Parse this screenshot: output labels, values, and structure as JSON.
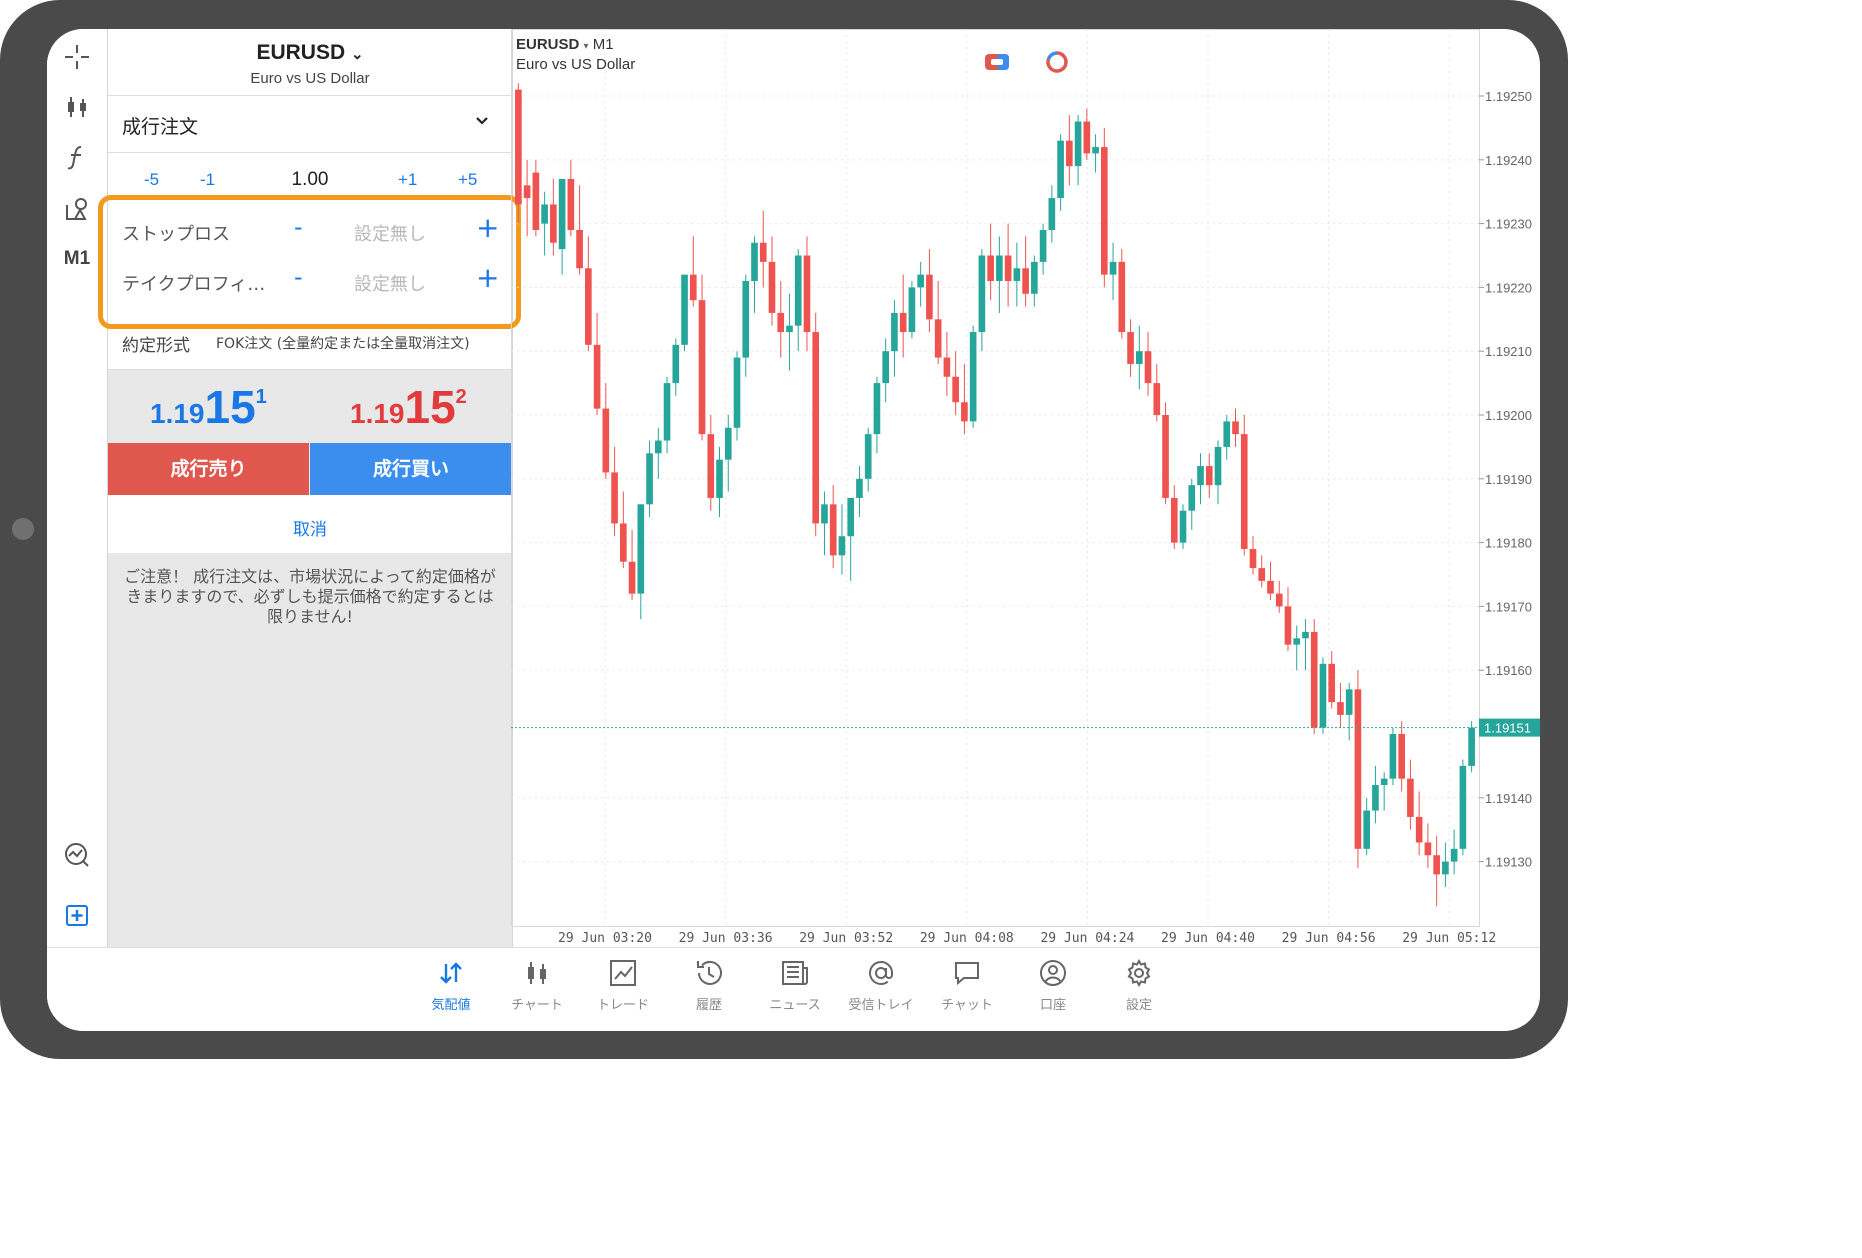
{
  "colors": {
    "accent": "#1a78e6",
    "bull": "#26a69a",
    "bear": "#ef5350",
    "sell": "#e0574d",
    "buy": "#3b8dee",
    "highlight": "#f39a1e"
  },
  "toolbar": {
    "icons": [
      "crosshair-icon",
      "chart-type-icon",
      "indicator-icon",
      "objects-icon"
    ],
    "timeframe": "M1",
    "bottom_icons": [
      "signal-analysis-icon",
      "new-order-icon"
    ]
  },
  "order": {
    "symbol": "EURUSD",
    "symbol_desc": "Euro vs US Dollar",
    "type": "成行注文",
    "volume": {
      "minus5": "-5",
      "minus1": "-1",
      "value": "1.00",
      "plus1": "+1",
      "plus5": "+5"
    },
    "stop_loss": {
      "label": "ストップロス",
      "minus": "-",
      "value": "設定無し",
      "plus": "+"
    },
    "take_profit": {
      "label": "テイクプロフィ…",
      "minus": "-",
      "value": "設定無し",
      "plus": "+"
    },
    "fill_policy": {
      "label": "約定形式",
      "value": "FOK注文 (全量約定または全量取消注文)"
    },
    "bid": {
      "small": "1.19",
      "big": "15",
      "sup": "1"
    },
    "ask": {
      "small": "1.19",
      "big": "15",
      "sup": "2"
    },
    "sell_label": "成行売り",
    "buy_label": "成行買い",
    "cancel_label": "取消",
    "warning": "ご注意！ 成行注文は、市場状況によって約定価格がきまりますので、必ずしも提示価格で約定するとは限りません!"
  },
  "chart": {
    "symbol": "EURUSD",
    "timeframe": "M1",
    "description": "Euro vs US Dollar",
    "icons": [
      "one-click-trading-icon",
      "signal-icon"
    ]
  },
  "chart_data": {
    "type": "candlestick",
    "symbol": "EURUSD",
    "timeframe": "M1",
    "y_ticks": [
      "1.19250",
      "1.19240",
      "1.19230",
      "1.19220",
      "1.19210",
      "1.19200",
      "1.19190",
      "1.19180",
      "1.19170",
      "1.19160",
      "1.19140",
      "1.19130"
    ],
    "x_ticks": [
      "29 Jun 03:20",
      "29 Jun 03:36",
      "29 Jun 03:52",
      "29 Jun 04:08",
      "29 Jun 04:24",
      "29 Jun 04:40",
      "29 Jun 04:56",
      "29 Jun 05:12"
    ],
    "current_price": "1.19151",
    "grid": true,
    "candles": [
      [
        1.19251,
        1.19252,
        1.1923,
        1.19233
      ],
      [
        1.19236,
        1.1924,
        1.19228,
        1.19234
      ],
      [
        1.19238,
        1.1924,
        1.19228,
        1.19229
      ],
      [
        1.1923,
        1.19235,
        1.19225,
        1.19233
      ],
      [
        1.19233,
        1.19237,
        1.19225,
        1.19227
      ],
      [
        1.19226,
        1.19237,
        1.19222,
        1.19237
      ],
      [
        1.19237,
        1.1924,
        1.19228,
        1.19229
      ],
      [
        1.19229,
        1.19236,
        1.19222,
        1.19223
      ],
      [
        1.19223,
        1.19228,
        1.1921,
        1.19211
      ],
      [
        1.19211,
        1.19216,
        1.192,
        1.19201
      ],
      [
        1.19201,
        1.19205,
        1.1919,
        1.19191
      ],
      [
        1.19191,
        1.19195,
        1.19181,
        1.19183
      ],
      [
        1.19183,
        1.19188,
        1.19176,
        1.19177
      ],
      [
        1.19177,
        1.19182,
        1.19171,
        1.19172
      ],
      [
        1.19172,
        1.19186,
        1.19168,
        1.19186
      ],
      [
        1.19186,
        1.19196,
        1.19184,
        1.19194
      ],
      [
        1.19194,
        1.19198,
        1.1919,
        1.19196
      ],
      [
        1.19196,
        1.19206,
        1.19194,
        1.19205
      ],
      [
        1.19205,
        1.19212,
        1.19203,
        1.19211
      ],
      [
        1.19211,
        1.19222,
        1.1921,
        1.19222
      ],
      [
        1.19222,
        1.19228,
        1.19217,
        1.19218
      ],
      [
        1.19218,
        1.19222,
        1.19196,
        1.19197
      ],
      [
        1.19197,
        1.192,
        1.19185,
        1.19187
      ],
      [
        1.19187,
        1.19195,
        1.19184,
        1.19193
      ],
      [
        1.19193,
        1.192,
        1.19188,
        1.19198
      ],
      [
        1.19198,
        1.1921,
        1.19196,
        1.19209
      ],
      [
        1.19209,
        1.19222,
        1.19206,
        1.19221
      ],
      [
        1.19221,
        1.19228,
        1.19216,
        1.19227
      ],
      [
        1.19227,
        1.19232,
        1.1922,
        1.19224
      ],
      [
        1.19224,
        1.19228,
        1.19214,
        1.19216
      ],
      [
        1.19216,
        1.19221,
        1.19209,
        1.19213
      ],
      [
        1.19213,
        1.19219,
        1.19207,
        1.19214
      ],
      [
        1.19214,
        1.19226,
        1.1921,
        1.19225
      ],
      [
        1.19225,
        1.19228,
        1.1921,
        1.19213
      ],
      [
        1.19213,
        1.19216,
        1.19181,
        1.19183
      ],
      [
        1.19183,
        1.19188,
        1.19178,
        1.19186
      ],
      [
        1.19186,
        1.19189,
        1.19176,
        1.19178
      ],
      [
        1.19178,
        1.19186,
        1.19175,
        1.19181
      ],
      [
        1.19181,
        1.19186,
        1.19174,
        1.19187
      ],
      [
        1.19187,
        1.19192,
        1.19184,
        1.1919
      ],
      [
        1.1919,
        1.19198,
        1.19188,
        1.19197
      ],
      [
        1.19197,
        1.19206,
        1.19194,
        1.19205
      ],
      [
        1.19205,
        1.19212,
        1.19202,
        1.1921
      ],
      [
        1.1921,
        1.19218,
        1.19206,
        1.19216
      ],
      [
        1.19216,
        1.19222,
        1.19209,
        1.19213
      ],
      [
        1.19213,
        1.19221,
        1.19212,
        1.1922
      ],
      [
        1.1922,
        1.19224,
        1.19217,
        1.19222
      ],
      [
        1.19222,
        1.19226,
        1.19213,
        1.19215
      ],
      [
        1.19215,
        1.19221,
        1.19208,
        1.19209
      ],
      [
        1.19209,
        1.19213,
        1.19203,
        1.19206
      ],
      [
        1.19206,
        1.1921,
        1.192,
        1.19202
      ],
      [
        1.19202,
        1.19208,
        1.19197,
        1.19199
      ],
      [
        1.19199,
        1.19214,
        1.19198,
        1.19213
      ],
      [
        1.19213,
        1.19226,
        1.1921,
        1.19225
      ],
      [
        1.19225,
        1.1923,
        1.19218,
        1.19221
      ],
      [
        1.19221,
        1.19228,
        1.19216,
        1.19225
      ],
      [
        1.19225,
        1.1923,
        1.19217,
        1.19221
      ],
      [
        1.19221,
        1.19227,
        1.19217,
        1.19223
      ],
      [
        1.19223,
        1.19228,
        1.19217,
        1.19219
      ],
      [
        1.19219,
        1.19225,
        1.19217,
        1.19224
      ],
      [
        1.19224,
        1.1923,
        1.19222,
        1.19229
      ],
      [
        1.19229,
        1.19236,
        1.19227,
        1.19234
      ],
      [
        1.19234,
        1.19244,
        1.19232,
        1.19243
      ],
      [
        1.19243,
        1.19247,
        1.19236,
        1.19239
      ],
      [
        1.19239,
        1.19247,
        1.19236,
        1.19246
      ],
      [
        1.19246,
        1.19248,
        1.1924,
        1.19241
      ],
      [
        1.19241,
        1.19244,
        1.19238,
        1.19242
      ],
      [
        1.19242,
        1.19245,
        1.1922,
        1.19222
      ],
      [
        1.19222,
        1.19227,
        1.19218,
        1.19224
      ],
      [
        1.19224,
        1.19226,
        1.19212,
        1.19213
      ],
      [
        1.19213,
        1.19215,
        1.19206,
        1.19208
      ],
      [
        1.19208,
        1.19214,
        1.19204,
        1.1921
      ],
      [
        1.1921,
        1.19213,
        1.19203,
        1.19205
      ],
      [
        1.19205,
        1.19208,
        1.19199,
        1.192
      ],
      [
        1.192,
        1.19202,
        1.19186,
        1.19187
      ],
      [
        1.19187,
        1.19189,
        1.19179,
        1.1918
      ],
      [
        1.1918,
        1.19186,
        1.19179,
        1.19185
      ],
      [
        1.19185,
        1.1919,
        1.19182,
        1.19189
      ],
      [
        1.19189,
        1.19194,
        1.19186,
        1.19192
      ],
      [
        1.19192,
        1.19194,
        1.19187,
        1.19189
      ],
      [
        1.19189,
        1.19196,
        1.19186,
        1.19195
      ],
      [
        1.19195,
        1.192,
        1.19193,
        1.19199
      ],
      [
        1.19199,
        1.19201,
        1.19195,
        1.19197
      ],
      [
        1.19197,
        1.192,
        1.19178,
        1.19179
      ],
      [
        1.19179,
        1.19181,
        1.19175,
        1.19176
      ],
      [
        1.19176,
        1.19178,
        1.19173,
        1.19174
      ],
      [
        1.19174,
        1.19177,
        1.19171,
        1.19172
      ],
      [
        1.19172,
        1.19174,
        1.19169,
        1.1917
      ],
      [
        1.1917,
        1.19173,
        1.19163,
        1.19164
      ],
      [
        1.19164,
        1.19167,
        1.1916,
        1.19165
      ],
      [
        1.19165,
        1.19168,
        1.1916,
        1.19166
      ],
      [
        1.19166,
        1.19168,
        1.1915,
        1.19151
      ],
      [
        1.19151,
        1.19162,
        1.1915,
        1.19161
      ],
      [
        1.19161,
        1.19163,
        1.19154,
        1.19155
      ],
      [
        1.19155,
        1.19158,
        1.19151,
        1.19153
      ],
      [
        1.19153,
        1.19158,
        1.19149,
        1.19157
      ],
      [
        1.19157,
        1.1916,
        1.19129,
        1.19132
      ],
      [
        1.19132,
        1.1914,
        1.19131,
        1.19138
      ],
      [
        1.19138,
        1.19145,
        1.19136,
        1.19142
      ],
      [
        1.19142,
        1.19144,
        1.19138,
        1.19143
      ],
      [
        1.19143,
        1.19151,
        1.19142,
        1.1915
      ],
      [
        1.1915,
        1.19152,
        1.19141,
        1.19143
      ],
      [
        1.19143,
        1.19146,
        1.19135,
        1.19137
      ],
      [
        1.19137,
        1.19141,
        1.19131,
        1.19133
      ],
      [
        1.19133,
        1.19136,
        1.19129,
        1.19131
      ],
      [
        1.19131,
        1.19134,
        1.19123,
        1.19128
      ],
      [
        1.19128,
        1.19133,
        1.19126,
        1.1913
      ],
      [
        1.1913,
        1.19135,
        1.19128,
        1.19132
      ],
      [
        1.19132,
        1.19146,
        1.19131,
        1.19145
      ],
      [
        1.19145,
        1.19152,
        1.19144,
        1.19151
      ]
    ]
  },
  "tabs": [
    {
      "label": "気配値",
      "icon": "quotes-icon",
      "active": true
    },
    {
      "label": "チャート",
      "icon": "chart-icon",
      "active": false
    },
    {
      "label": "トレード",
      "icon": "trade-icon",
      "active": false
    },
    {
      "label": "履歴",
      "icon": "history-icon",
      "active": false
    },
    {
      "label": "ニュース",
      "icon": "news-icon",
      "active": false
    },
    {
      "label": "受信トレイ",
      "icon": "mailbox-icon",
      "active": false
    },
    {
      "label": "チャット",
      "icon": "chat-icon",
      "active": false
    },
    {
      "label": "口座",
      "icon": "account-icon",
      "active": false
    },
    {
      "label": "設定",
      "icon": "settings-icon",
      "active": false
    }
  ]
}
